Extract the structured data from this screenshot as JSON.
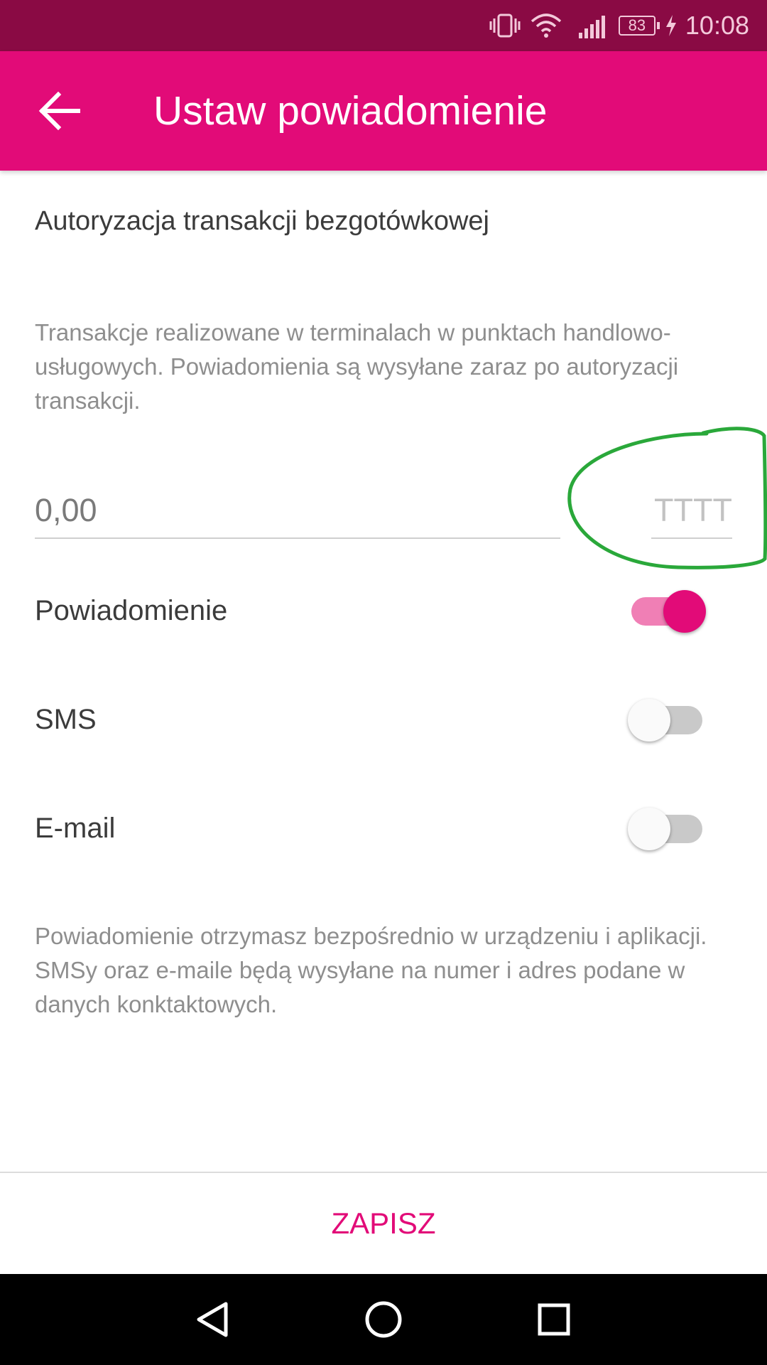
{
  "status_bar": {
    "time": "10:08",
    "battery": "83",
    "icons": [
      "vibrate-icon",
      "wifi-icon",
      "signal-icon",
      "battery-icon",
      "charging-icon"
    ]
  },
  "app_bar": {
    "title": "Ustaw powiadomienie",
    "back_icon": "arrow-left-icon"
  },
  "content": {
    "section_title": "Autoryzacja transakcji bezgotówkowej",
    "description": "Transakcje realizowane w terminalach w punktach handlowo-usługowych. Powiadomienia są wysyłane zaraz po autoryzacji transakcji.",
    "amount_placeholder": "0,00",
    "currency_placeholder": "TTTT",
    "toggles": [
      {
        "label": "Powiadomienie",
        "on": true
      },
      {
        "label": "SMS",
        "on": false
      },
      {
        "label": "E-mail",
        "on": false
      }
    ],
    "footer_note": "Powiadomienie otrzymasz bezpośrednio w urządzeniu i aplikacji. SMSy oraz e-maile będą wysyłane na numer i adres podane w danych konktaktowych."
  },
  "actions": {
    "save_label": "ZAPISZ"
  },
  "colors": {
    "status_bar": "#8a0a44",
    "accent": "#e20b78",
    "accent_light": "#f07fb5",
    "annotation": "#2aa83a"
  },
  "nav_bar": {
    "icons": [
      "nav-back-icon",
      "nav-home-icon",
      "nav-recents-icon"
    ]
  }
}
